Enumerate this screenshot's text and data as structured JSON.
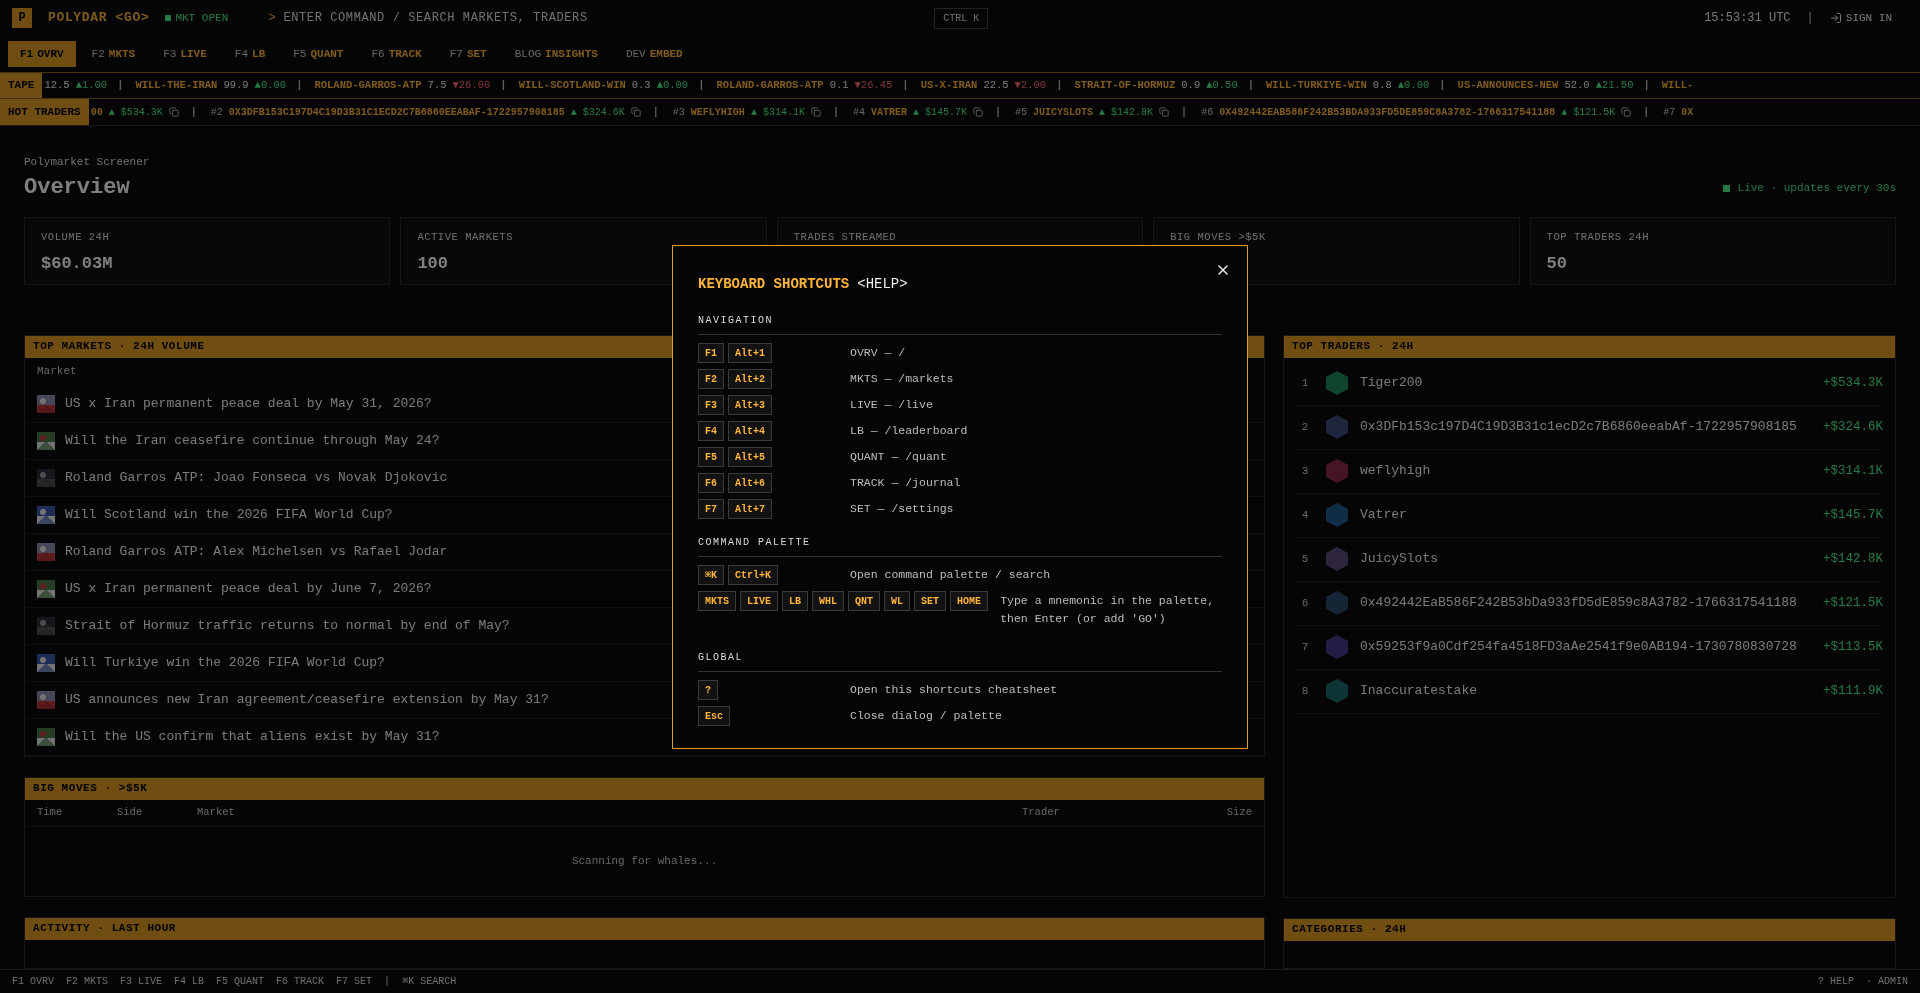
{
  "topbar": {
    "logo": "P",
    "brand": "POLYDAR <GO>",
    "market_status": "MKT OPEN",
    "command": {
      "prompt": ">",
      "placeholder": "ENTER COMMAND / SEARCH MARKETS, TRADERS",
      "shortcut": "CTRL K"
    },
    "clock": "15:53:31 UTC",
    "separator": "|",
    "sign_in": "SIGN IN"
  },
  "tabs": [
    {
      "key": "F1",
      "label": "OVRV",
      "selected": true
    },
    {
      "key": "F2",
      "label": "MKTS",
      "selected": false
    },
    {
      "key": "F3",
      "label": "LIVE",
      "selected": false
    },
    {
      "key": "F4",
      "label": "LB",
      "selected": false
    },
    {
      "key": "F5",
      "label": "QUANT",
      "selected": false
    },
    {
      "key": "F6",
      "label": "TRACK",
      "selected": false
    },
    {
      "key": "F7",
      "label": "SET",
      "selected": false
    },
    {
      "key": "BLOG",
      "label": "INSIGHTS",
      "selected": false
    },
    {
      "key": "DEV",
      "label": "EMBED",
      "selected": false
    }
  ],
  "tape": {
    "label": "TAPE",
    "separator": "|",
    "items": [
      {
        "price": "12.5",
        "kind": "up",
        "arrow": "▲",
        "change": "1.00"
      },
      {
        "name": "WILL-THE-IRAN",
        "price": "99.9",
        "kind": "up",
        "arrow": "▲",
        "change": "0.00"
      },
      {
        "name": "ROLAND-GARROS-ATP",
        "price": "7.5",
        "kind": "down",
        "arrow": "▼",
        "change": "26.00"
      },
      {
        "name": "WILL-SCOTLAND-WIN",
        "price": "0.3",
        "kind": "up",
        "arrow": "▲",
        "change": "0.00"
      },
      {
        "name": "ROLAND-GARROS-ATP",
        "price": "0.1",
        "kind": "down",
        "arrow": "▼",
        "change": "26.45"
      },
      {
        "name": "US-X-IRAN",
        "price": "22.5",
        "kind": "down",
        "arrow": "▼",
        "change": "2.00"
      },
      {
        "name": "STRAIT-OF-HORMUZ",
        "price": "0.9",
        "kind": "up",
        "arrow": "▲",
        "change": "0.50"
      },
      {
        "name": "WILL-TURKIYE-WIN",
        "price": "0.8",
        "kind": "up",
        "arrow": "▲",
        "change": "0.00"
      },
      {
        "name": "US-ANNOUNCES-NEW",
        "price": "52.0",
        "kind": "up",
        "arrow": "▲",
        "change": "21.50"
      },
      {
        "name": "WILL-"
      }
    ]
  },
  "hot_traders": {
    "label": "HOT TRADERS",
    "separator": "|",
    "items": [
      {
        "name": "00",
        "arrow": "▲",
        "value": "$534.3K"
      },
      {
        "rank": "#2",
        "name": "0X3DFB153C197D4C19D3B31C1ECD2C7B6860EEABAF-1722957908185",
        "arrow": "▲",
        "value": "$324.6K"
      },
      {
        "rank": "#3",
        "name": "WEFLYHIGH",
        "arrow": "▲",
        "value": "$314.1K"
      },
      {
        "rank": "#4",
        "name": "VATRER",
        "arrow": "▲",
        "value": "$145.7K"
      },
      {
        "rank": "#5",
        "name": "JUICYSLOTS",
        "arrow": "▲",
        "value": "$142.8K"
      },
      {
        "rank": "#6",
        "name": "0X492442EAB586F242B53BDA933FD5DE859C8A3782-1766317541188",
        "arrow": "▲",
        "value": "$121.5K"
      },
      {
        "rank": "#7",
        "name": "0X"
      }
    ]
  },
  "page": {
    "eyebrow": "Polymarket Screener",
    "title": "Overview",
    "live": "Live · updates every 30s"
  },
  "stats": [
    {
      "label": "VOLUME 24H",
      "value": "$60.03M"
    },
    {
      "label": "ACTIVE MARKETS",
      "value": "100"
    },
    {
      "label": "TRADES STREAMED"
    },
    {
      "label": "BIG MOVES >$5K"
    },
    {
      "label": "TOP TRADERS 24H",
      "value": "50"
    }
  ],
  "top_markets": {
    "title": "TOP MARKETS · 24H VOLUME",
    "column": "Market",
    "rows": [
      "US x Iran permanent peace deal by May 31, 2026?",
      "Will the Iran ceasefire continue through May 24?",
      "Roland Garros ATP: Joao Fonseca vs Novak Djokovic",
      "Will Scotland win the 2026 FIFA World Cup?",
      "Roland Garros ATP: Alex Michelsen vs Rafael Jodar",
      "US x Iran permanent peace deal by June 7, 2026?",
      "Strait of Hormuz traffic returns to normal by end of May?",
      "Will Turkiye win the 2026 FIFA World Cup?",
      "US announces new Iran agreement/ceasefire extension by May 31?",
      "Will the US confirm that aliens exist by May 31?"
    ]
  },
  "top_traders": {
    "title": "TOP TRADERS · 24H",
    "rows": [
      {
        "rank": "1",
        "name": "Tiger200",
        "pnl": "+$534.3K"
      },
      {
        "rank": "2",
        "name": "0x3DFb153c197D4C19D3B31c1ecD2c7B6860eeabAf-1722957908185",
        "pnl": "+$324.6K"
      },
      {
        "rank": "3",
        "name": "weflyhigh",
        "pnl": "+$314.1K"
      },
      {
        "rank": "4",
        "name": "Vatrer",
        "pnl": "+$145.7K"
      },
      {
        "rank": "5",
        "name": "JuicySlots",
        "pnl": "+$142.8K"
      },
      {
        "rank": "6",
        "name": "0x492442EaB586F242B53bDa933fD5dE859c8A3782-1766317541188",
        "pnl": "+$121.5K"
      },
      {
        "rank": "7",
        "name": "0x59253f9a0Cdf254fa4518FD3aAe2541f9e0AB194-1730780830728",
        "pnl": "+$113.5K"
      },
      {
        "rank": "8",
        "name": "Inaccuratestake",
        "pnl": "+$111.9K"
      }
    ]
  },
  "big_moves": {
    "title": "BIG MOVES · >$5K",
    "columns": [
      "Time",
      "Side",
      "Market",
      "Trader",
      "Size"
    ],
    "empty": "Scanning for whales..."
  },
  "activity": {
    "title": "ACTIVITY · LAST HOUR"
  },
  "categories": {
    "title": "CATEGORIES · 24H"
  },
  "status_bar": {
    "items": [
      "F1 OVRV",
      "F2 MKTS",
      "F3 LIVE",
      "F4 LB",
      "F5 QUANT",
      "F6 TRACK",
      "F7 SET"
    ],
    "separator": "|",
    "search": "⌘K SEARCH",
    "help": "? HELP",
    "admin": "· ADMIN"
  },
  "dialog": {
    "title": "KEYBOARD SHORTCUTS",
    "tag": "<HELP>",
    "sections": [
      {
        "title": "NAVIGATION",
        "rows": [
          {
            "keys": [
              "F1",
              "Alt+1"
            ],
            "desc": "OVRV — /"
          },
          {
            "keys": [
              "F2",
              "Alt+2"
            ],
            "desc": "MKTS — /markets"
          },
          {
            "keys": [
              "F3",
              "Alt+3"
            ],
            "desc": "LIVE — /live"
          },
          {
            "keys": [
              "F4",
              "Alt+4"
            ],
            "desc": "LB — /leaderboard"
          },
          {
            "keys": [
              "F5",
              "Alt+5"
            ],
            "desc": "QUANT — /quant"
          },
          {
            "keys": [
              "F6",
              "Alt+6"
            ],
            "desc": "TRACK — /journal"
          },
          {
            "keys": [
              "F7",
              "Alt+7"
            ],
            "desc": "SET — /settings"
          }
        ]
      },
      {
        "title": "COMMAND PALETTE",
        "rows": [
          {
            "keys": [
              "⌘K",
              "Ctrl+K"
            ],
            "desc": "Open command palette / search"
          },
          {
            "keys": [
              "MKTS",
              "LIVE",
              "LB",
              "WHL",
              "QNT",
              "WL",
              "SET",
              "HOME"
            ],
            "desc": "Type a mnemonic in the palette, then Enter (or add 'GO')"
          }
        ]
      },
      {
        "title": "GLOBAL",
        "rows": [
          {
            "keys": [
              "?"
            ],
            "desc": "Open this shortcuts cheatsheet"
          },
          {
            "keys": [
              "Esc"
            ],
            "desc": "Close dialog / palette"
          }
        ]
      }
    ]
  }
}
